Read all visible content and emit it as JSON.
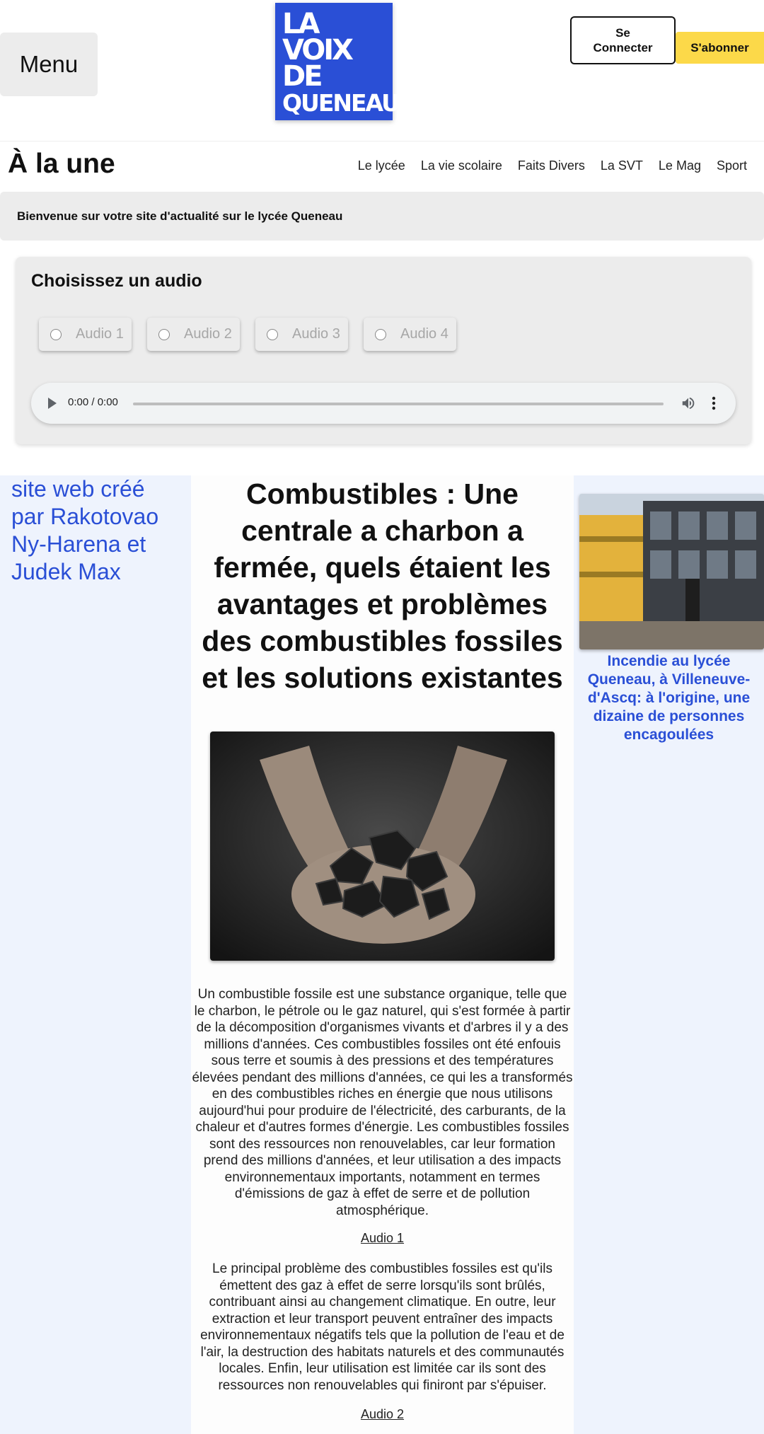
{
  "header": {
    "menu_label": "Menu",
    "logo_lines": [
      "LA",
      "VOIX",
      "DE",
      "QUENEAU"
    ],
    "login_label": "Se Connecter",
    "subscribe_label": "S'abonner",
    "colors": {
      "brand_blue": "#2a4fd6",
      "subscribe_yellow": "#fcd949"
    }
  },
  "nav": {
    "title": "À la une",
    "links": [
      "Le lycée",
      "La vie scolaire",
      "Faits Divers",
      "La SVT",
      "Le Mag",
      "Sport"
    ]
  },
  "welcome": "Bienvenue sur votre site d'actualité sur le lycée Queneau",
  "audio_panel": {
    "title": "Choisissez un audio",
    "options": [
      "Audio 1",
      "Audio 2",
      "Audio 3",
      "Audio 4"
    ],
    "player": {
      "time": "0:00 / 0:00"
    }
  },
  "credits": "site web créé par Rakotovao Ny-Harena et Judek Max",
  "article": {
    "title": "Combustibles : Une centrale a charbon a fermée, quels étaient les avantages et problèmes des combustibles fossiles et les solutions existantes",
    "image_icon": "coal-in-hands-image",
    "paragraph1": "Un combustible fossile est une substance organique, telle que le charbon, le pétrole ou le gaz naturel, qui s'est formée à partir de la décomposition d'organismes vivants et d'arbres il y a des millions d'années. Ces combustibles fossiles ont été enfouis sous terre et soumis à des pressions et des températures élevées pendant des millions d'années, ce qui les a transformés en des combustibles riches en énergie que nous utilisons aujourd'hui pour produire de l'électricité, des carburants, de la chaleur et d'autres formes d'énergie. Les combustibles fossiles sont des ressources non renouvelables, car leur formation prend des millions d'années, et leur utilisation a des impacts environnementaux importants, notamment en termes d'émissions de gaz à effet de serre et de pollution atmosphérique.",
    "audio_link_1": "Audio 1",
    "paragraph2": "Le principal problème des combustibles fossiles est qu'ils émettent des gaz à effet de serre lorsqu'ils sont brûlés, contribuant ainsi au changement climatique. En outre, leur extraction et leur transport peuvent entraîner des impacts environnementaux négatifs tels que la pollution de l'eau et de l'air, la destruction des habitats naturels et des communautés locales. Enfin, leur utilisation est limitée car ils sont des ressources non renouvelables qui finiront par s'épuiser.",
    "audio_link_2": "Audio 2"
  },
  "sidebar": {
    "image_icon": "school-building-image",
    "headline": "Incendie au lycée Queneau, à Villeneuve-d'Ascq: à l'origine, une dizaine de personnes encagoulées"
  }
}
